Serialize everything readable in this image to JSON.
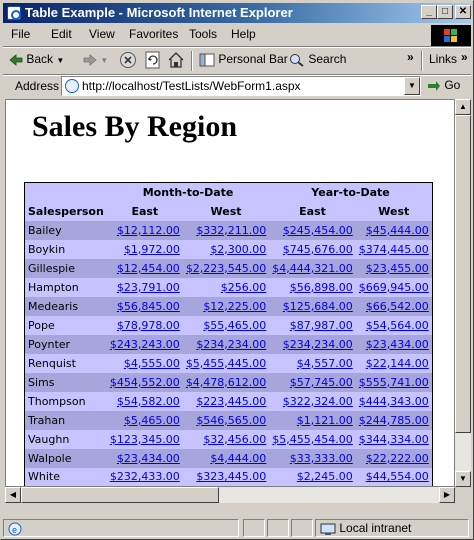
{
  "window": {
    "title": "Table Example - Microsoft Internet Explorer",
    "buttons": {
      "minimize": "_",
      "maximize": "□",
      "close": "✕"
    }
  },
  "menu": [
    "File",
    "Edit",
    "View",
    "Favorites",
    "Tools",
    "Help"
  ],
  "toolbar": {
    "back": "Back",
    "personal_bar": "Personal Bar",
    "search": "Search",
    "links": "Links",
    "more": "»"
  },
  "address": {
    "label": "Address",
    "url": "http://localhost/TestLists/WebForm1.aspx",
    "go": "Go"
  },
  "page": {
    "title": "Sales By Region",
    "table": {
      "group_headers": [
        "Month-to-Date",
        "Year-to-Date"
      ],
      "columns": [
        "Salesperson",
        "East",
        "West",
        "East",
        "West"
      ],
      "rows": [
        {
          "name": "Bailey",
          "mtd_east": "$12,112.00",
          "mtd_west": "$332,211.00",
          "ytd_east": "$245,454.00",
          "ytd_west": "$45,444.00"
        },
        {
          "name": "Boykin",
          "mtd_east": "$1,972.00",
          "mtd_west": "$2,300.00",
          "ytd_east": "$745,676.00",
          "ytd_west": "$374,445.00"
        },
        {
          "name": "Gillespie",
          "mtd_east": "$12,454.00",
          "mtd_west": "$2,223,545.00",
          "ytd_east": "$4,444,321.00",
          "ytd_west": "$23,455.00"
        },
        {
          "name": "Hampton",
          "mtd_east": "$23,791.00",
          "mtd_west": "$256.00",
          "ytd_east": "$56,898.00",
          "ytd_west": "$669,945.00"
        },
        {
          "name": "Medearis",
          "mtd_east": "$56,845.00",
          "mtd_west": "$12,225.00",
          "ytd_east": "$125,684.00",
          "ytd_west": "$66,542.00"
        },
        {
          "name": "Pope",
          "mtd_east": "$78,978.00",
          "mtd_west": "$55,465.00",
          "ytd_east": "$87,987.00",
          "ytd_west": "$54,564.00"
        },
        {
          "name": "Poynter",
          "mtd_east": "$243,243.00",
          "mtd_west": "$234,234.00",
          "ytd_east": "$234,234.00",
          "ytd_west": "$23,434.00"
        },
        {
          "name": "Renquist",
          "mtd_east": "$4,555.00",
          "mtd_west": "$5,455,445.00",
          "ytd_east": "$4,557.00",
          "ytd_west": "$22,144.00"
        },
        {
          "name": "Sims",
          "mtd_east": "$454,552.00",
          "mtd_west": "$4,478,612.00",
          "ytd_east": "$57,745.00",
          "ytd_west": "$555,741.00"
        },
        {
          "name": "Thompson",
          "mtd_east": "$54,582.00",
          "mtd_west": "$223,445.00",
          "ytd_east": "$322,324.00",
          "ytd_west": "$444,343.00"
        },
        {
          "name": "Trahan",
          "mtd_east": "$5,465.00",
          "mtd_west": "$546,565.00",
          "ytd_east": "$1,121.00",
          "ytd_west": "$244,785.00"
        },
        {
          "name": "Vaughn",
          "mtd_east": "$123,345.00",
          "mtd_west": "$32,456.00",
          "ytd_east": "$5,455,454.00",
          "ytd_west": "$344,334.00"
        },
        {
          "name": "Walpole",
          "mtd_east": "$23,434.00",
          "mtd_west": "$4,444.00",
          "ytd_east": "$33,333.00",
          "ytd_west": "$22,222.00"
        },
        {
          "name": "White",
          "mtd_east": "$232,433.00",
          "mtd_west": "$323,445.00",
          "ytd_east": "$2,245.00",
          "ytd_west": "$44,554.00"
        }
      ]
    }
  },
  "status": {
    "zone": "Local intranet"
  },
  "colors": {
    "header_bg": "#c6c3ff",
    "row_odd": "#a6a6dd",
    "row_even": "#c6c3ff",
    "link": "#0000ee"
  }
}
